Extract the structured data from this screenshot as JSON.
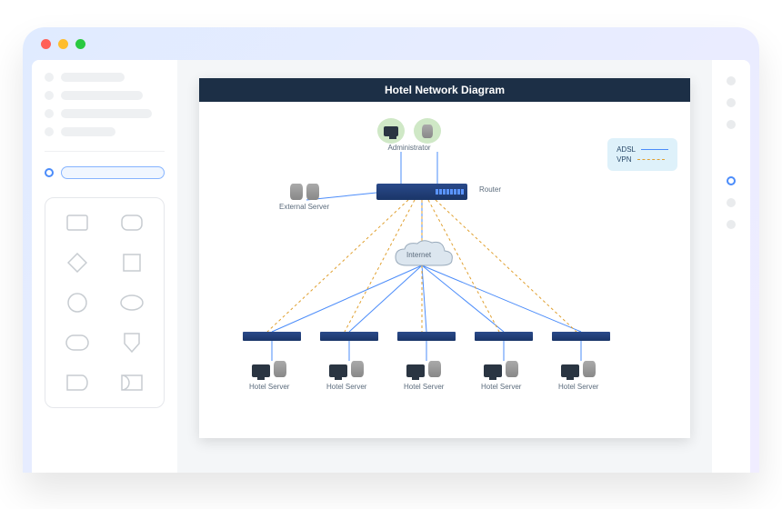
{
  "diagram": {
    "title": "Hotel Network Diagram",
    "legend": {
      "adsl": "ADSL",
      "vpn": "VPN"
    },
    "nodes": {
      "administrator": "Administrator",
      "router": "Router",
      "external_server": "External Server",
      "internet": "Internet",
      "hotel_server": "Hotel Server"
    },
    "hotel_count": 5,
    "connections": {
      "adsl_color": "#4b8cfa",
      "vpn_color": "#e0a030"
    }
  }
}
